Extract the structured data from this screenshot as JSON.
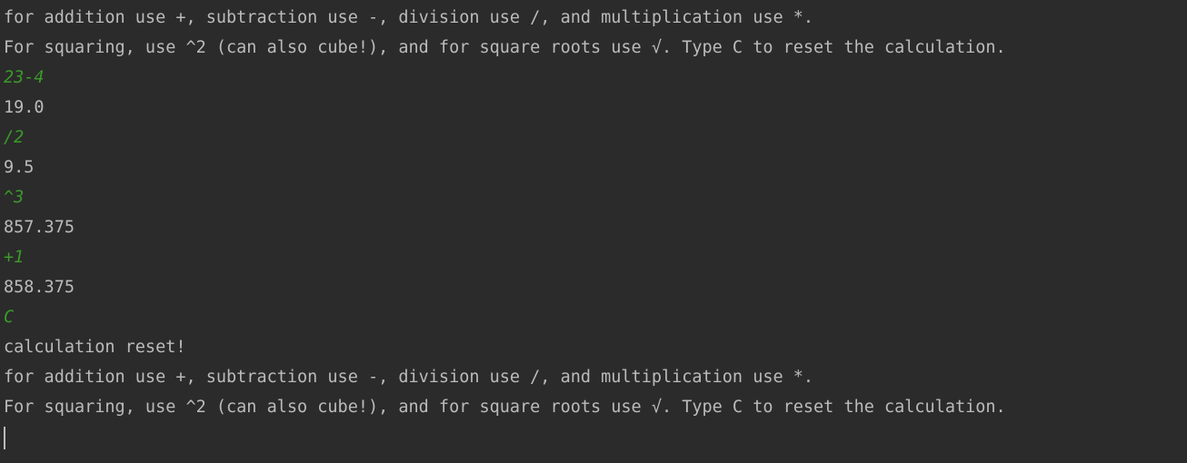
{
  "console": {
    "lines": [
      {
        "text": "for addition use +, subtraction use -, division use /, and multiplication use *.",
        "kind": "output"
      },
      {
        "text": "For squaring, use ^2 (can also cube!), and for square roots use √. Type C to reset the calculation.",
        "kind": "output"
      },
      {
        "text": "23-4",
        "kind": "input"
      },
      {
        "text": "19.0",
        "kind": "output"
      },
      {
        "text": "/2",
        "kind": "input"
      },
      {
        "text": "9.5",
        "kind": "output"
      },
      {
        "text": "^3",
        "kind": "input"
      },
      {
        "text": "857.375",
        "kind": "output"
      },
      {
        "text": "+1",
        "kind": "input"
      },
      {
        "text": "858.375",
        "kind": "output"
      },
      {
        "text": "C",
        "kind": "input"
      },
      {
        "text": "calculation reset!",
        "kind": "output"
      },
      {
        "text": "for addition use +, subtraction use -, division use /, and multiplication use *.",
        "kind": "output"
      },
      {
        "text": "For squaring, use ^2 (can also cube!), and for square roots use √. Type C to reset the calculation.",
        "kind": "output"
      }
    ]
  },
  "colors": {
    "background": "#2b2b2b",
    "output_text": "#bbbbbb",
    "input_text": "#3b9a2a"
  }
}
